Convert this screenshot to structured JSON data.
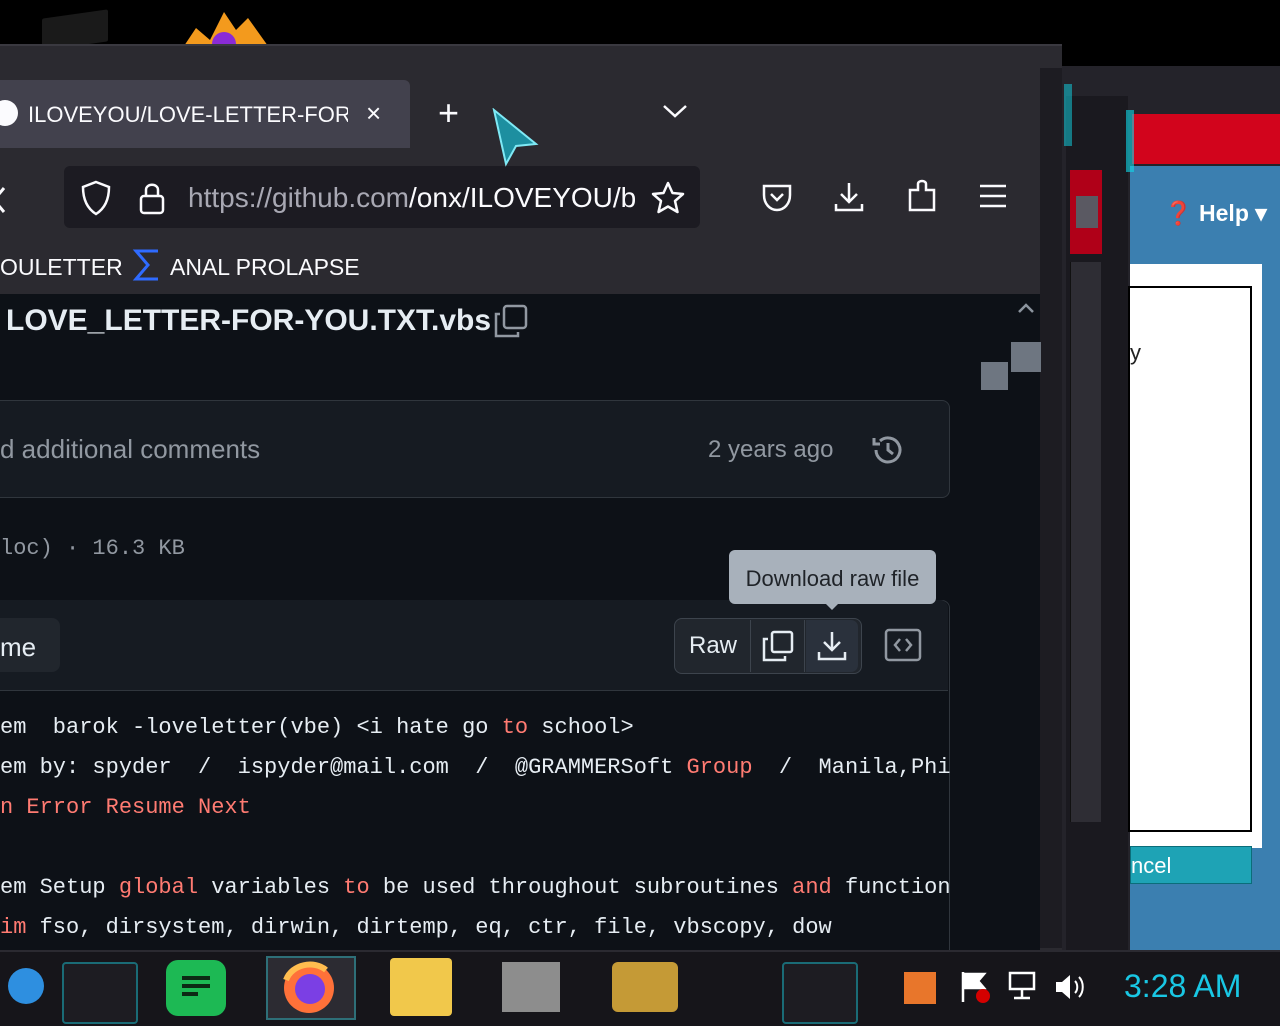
{
  "browser": {
    "tab_title": "ILOVEYOU/LOVE-LETTER-FOR-YOU.TXT.vbs",
    "tab_close": "×",
    "new_tab": "+",
    "url_host": "https://github.com",
    "url_path": "/onx/ILOVEYOU/b"
  },
  "bookmarks": {
    "item1": "OULETTER",
    "item2": "ANAL PROLAPSE"
  },
  "file": {
    "title": "LOVE_LETTER-FOR-YOU.TXT.vbs",
    "commit_message": "d additional comments",
    "commit_time": "2 years ago",
    "meta": "loc) · 16.3 KB",
    "code_tab": "me",
    "raw_label": "Raw",
    "tooltip": "Download raw file"
  },
  "code_lines": [
    {
      "segments": [
        {
          "t": "em  barok -loveletter(vbe) <i hate go ",
          "k": false
        },
        {
          "t": "to",
          "k": true
        },
        {
          "t": " school>",
          "k": false
        }
      ]
    },
    {
      "segments": [
        {
          "t": "em by: spyder  /  ispyder@mail.com  /  @GRAMMERSoft ",
          "k": false
        },
        {
          "t": "Group",
          "k": true
        },
        {
          "t": "  /  Manila,Phi",
          "k": false
        }
      ]
    },
    {
      "segments": [
        {
          "t": "n Error Resume Next",
          "k": true
        }
      ]
    },
    {
      "segments": [
        {
          "t": "",
          "k": false
        }
      ]
    },
    {
      "segments": [
        {
          "t": "em Setup ",
          "k": false
        },
        {
          "t": "global",
          "k": true
        },
        {
          "t": " variables ",
          "k": false
        },
        {
          "t": "to",
          "k": true
        },
        {
          "t": " be used throughout subroutines ",
          "k": false
        },
        {
          "t": "and",
          "k": true
        },
        {
          "t": " function",
          "k": false
        }
      ]
    },
    {
      "segments": [
        {
          "t": "im",
          "k": true
        },
        {
          "t": " fso, dirsystem, dirwin, dirtemp, eq, ctr, file, vbscopy, dow",
          "k": false
        }
      ]
    }
  ],
  "right_window": {
    "help": "Help",
    "text_y": "y",
    "cancel": "ncel"
  },
  "taskbar": {
    "clock": "3:28 AM"
  },
  "colors": {
    "keyword": "#ff7b72",
    "clock": "#19c7e4",
    "accent_red": "#d2041c"
  }
}
